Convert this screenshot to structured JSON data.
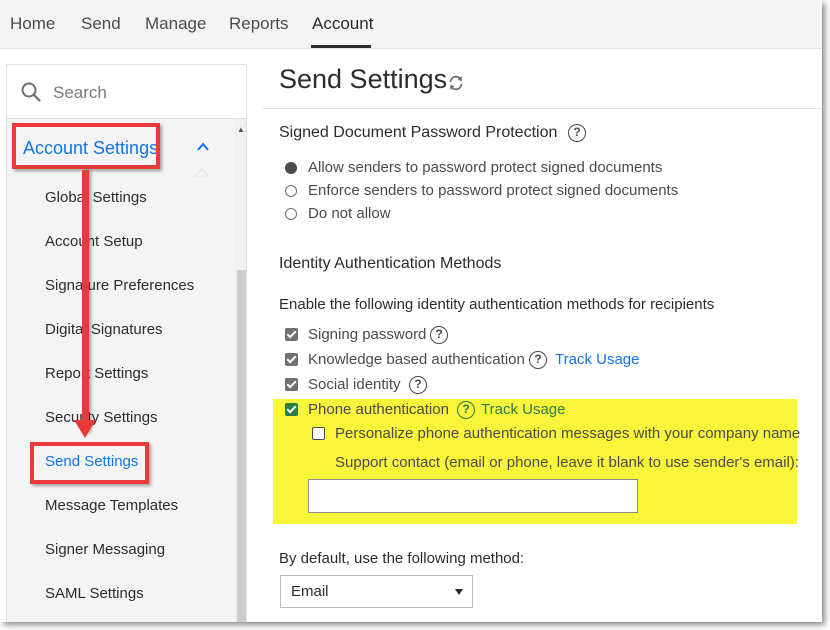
{
  "nav": {
    "tabs": [
      {
        "label": "Home"
      },
      {
        "label": "Send"
      },
      {
        "label": "Manage"
      },
      {
        "label": "Reports"
      },
      {
        "label": "Account"
      }
    ],
    "active": "Account"
  },
  "sidebar": {
    "search_placeholder": "Search",
    "section_label": "Account Settings",
    "items": [
      {
        "label": "Global Settings"
      },
      {
        "label": "Account Setup"
      },
      {
        "label": "Signature Preferences"
      },
      {
        "label": "Digital Signatures"
      },
      {
        "label": "Report Settings"
      },
      {
        "label": "Security Settings"
      },
      {
        "label": "Send Settings"
      },
      {
        "label": "Message Templates"
      },
      {
        "label": "Signer Messaging"
      },
      {
        "label": "SAML Settings"
      }
    ],
    "active_item": "Send Settings"
  },
  "main": {
    "title": "Send Settings",
    "password_protection": {
      "title": "Signed Document Password Protection",
      "options": [
        {
          "label": "Allow senders to password protect signed documents",
          "checked": true
        },
        {
          "label": "Enforce senders to password protect signed documents",
          "checked": false
        },
        {
          "label": "Do not allow",
          "checked": false
        }
      ]
    },
    "identity": {
      "title": "Identity Authentication Methods",
      "subtitle": "Enable the following identity authentication methods for recipients",
      "methods": [
        {
          "label": "Signing password",
          "checked": true
        },
        {
          "label": "Knowledge based authentication",
          "checked": true,
          "link": "Track Usage"
        },
        {
          "label": "Social identity",
          "checked": true
        },
        {
          "label": "Phone authentication",
          "checked": true,
          "link": "Track Usage"
        }
      ],
      "personalize_label": "Personalize phone authentication messages with your company name",
      "personalize_checked": false,
      "support_label": "Support contact (email or phone, leave it blank to use sender's email):",
      "support_value": ""
    },
    "default_method": {
      "label": "By default, use the following method:",
      "selected": "Email"
    }
  },
  "colors": {
    "accent": "#1473e6",
    "highlight": "#f9f53a",
    "annotation": "#e8393b",
    "check_green": "#2d7d46"
  }
}
